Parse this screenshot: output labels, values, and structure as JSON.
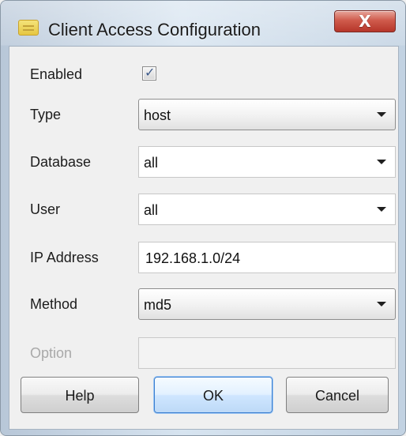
{
  "window": {
    "title": "Client Access Configuration",
    "close_glyph": "X"
  },
  "fields": {
    "enabled": {
      "label": "Enabled",
      "checked": true,
      "checkmark_glyph": "✓"
    },
    "type": {
      "label": "Type",
      "value": "host"
    },
    "database": {
      "label": "Database",
      "value": "all"
    },
    "user": {
      "label": "User",
      "value": "all"
    },
    "ip_address": {
      "label": "IP Address",
      "value": "192.168.1.0/24"
    },
    "method": {
      "label": "Method",
      "value": "md5"
    },
    "option": {
      "label": "Option",
      "value": ""
    }
  },
  "buttons": {
    "help": "Help",
    "ok": "OK",
    "cancel": "Cancel"
  },
  "icons": {
    "window_icon": "list-window-icon",
    "close_icon": "close-icon",
    "dropdown_icon": "chevron-down-icon",
    "checkbox_icon": "checkbox-checked-icon"
  },
  "colors": {
    "window_bg": "#f0f0f0",
    "close_red": "#cf5b4c",
    "ok_accent": "#3b7fd0",
    "disabled_text": "#a9a9a9"
  }
}
